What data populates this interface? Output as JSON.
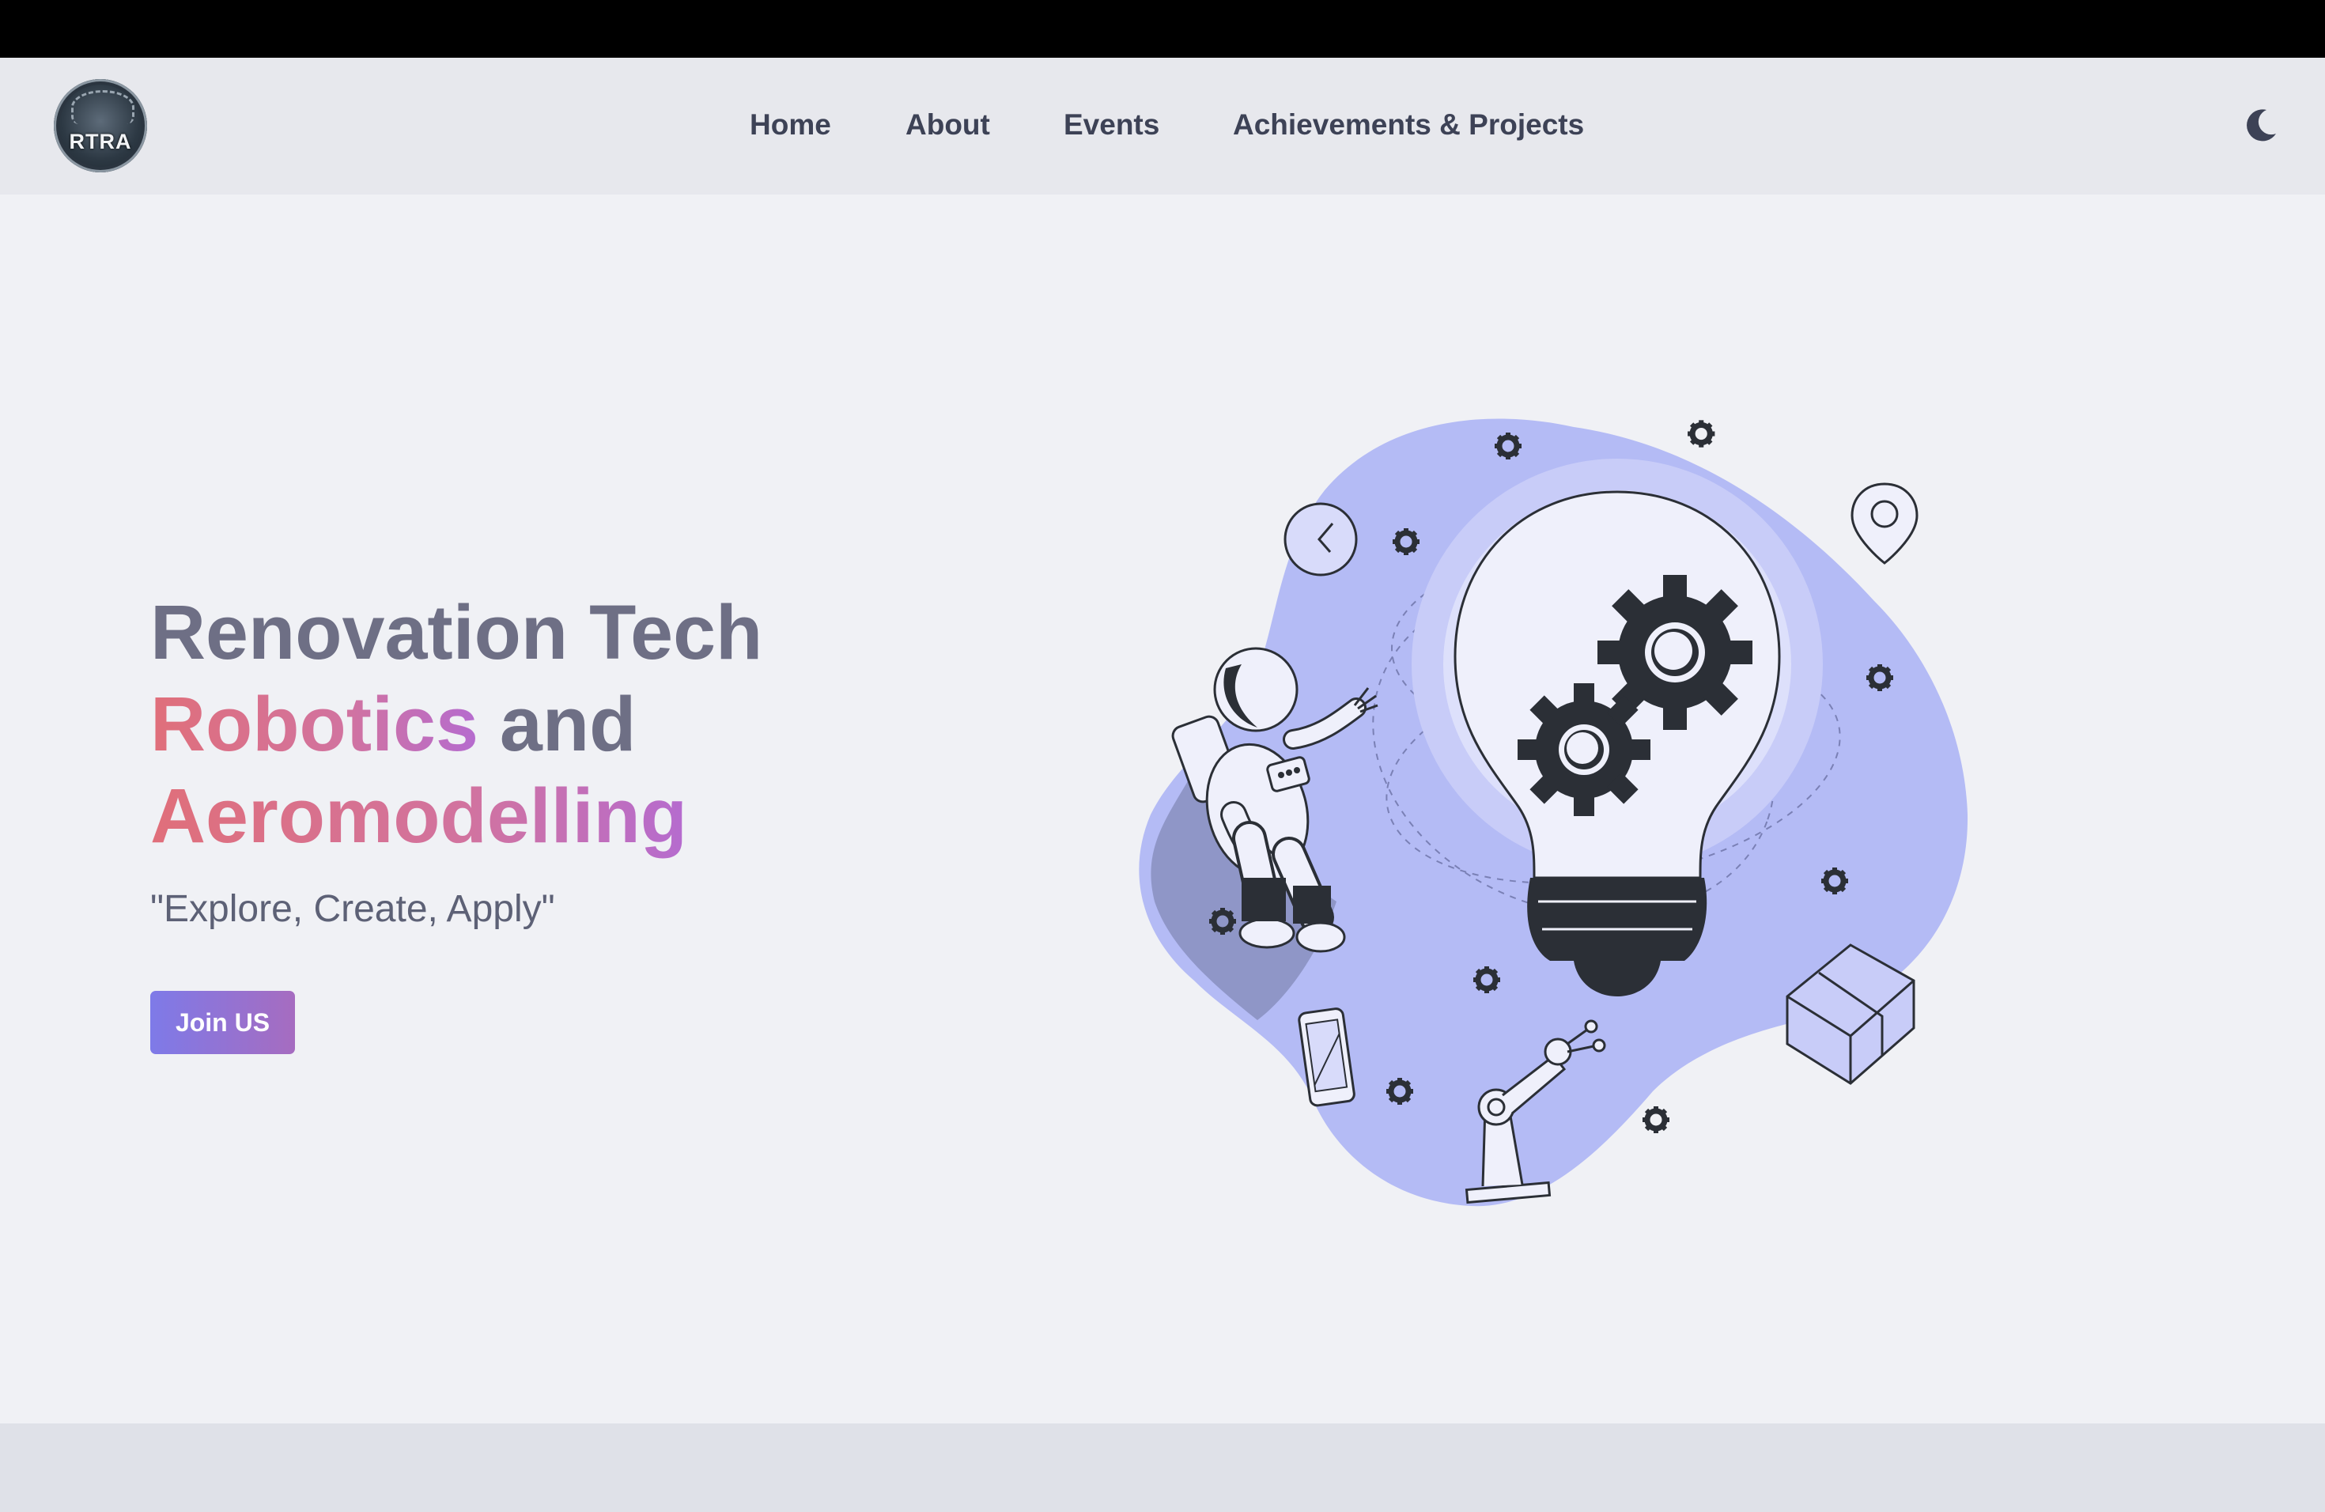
{
  "navbar": {
    "logo_text": "RTRA",
    "links": [
      {
        "label": "Home"
      },
      {
        "label": "About"
      },
      {
        "label": "Events"
      },
      {
        "label": "Achievements & Projects"
      }
    ],
    "theme_toggle_icon": "moon-icon"
  },
  "hero": {
    "title_line1": "Renovation Tech",
    "title_line2_accent": "Robotics",
    "title_line2_rest": " and",
    "title_line3_accent": "Aeromodelling",
    "tagline": "\"Explore, Create, Apply\"",
    "cta_label": "Join US"
  },
  "colors": {
    "background": "#f0f1f5",
    "navbar": "#e7e8ed",
    "title": "#6e6f85",
    "accent_gradient_start": "#e06f7a",
    "accent_gradient_end": "#b56bcf",
    "button_gradient_start": "#7e7ae8",
    "button_gradient_end": "#a66cc0",
    "blob": "#b4bbf5"
  },
  "illustration_icons": [
    "lightbulb-icon",
    "gear-icon",
    "astronaut-icon",
    "robot-arm-icon",
    "phone-icon",
    "box-icon",
    "location-pin-icon",
    "clock-icon"
  ]
}
